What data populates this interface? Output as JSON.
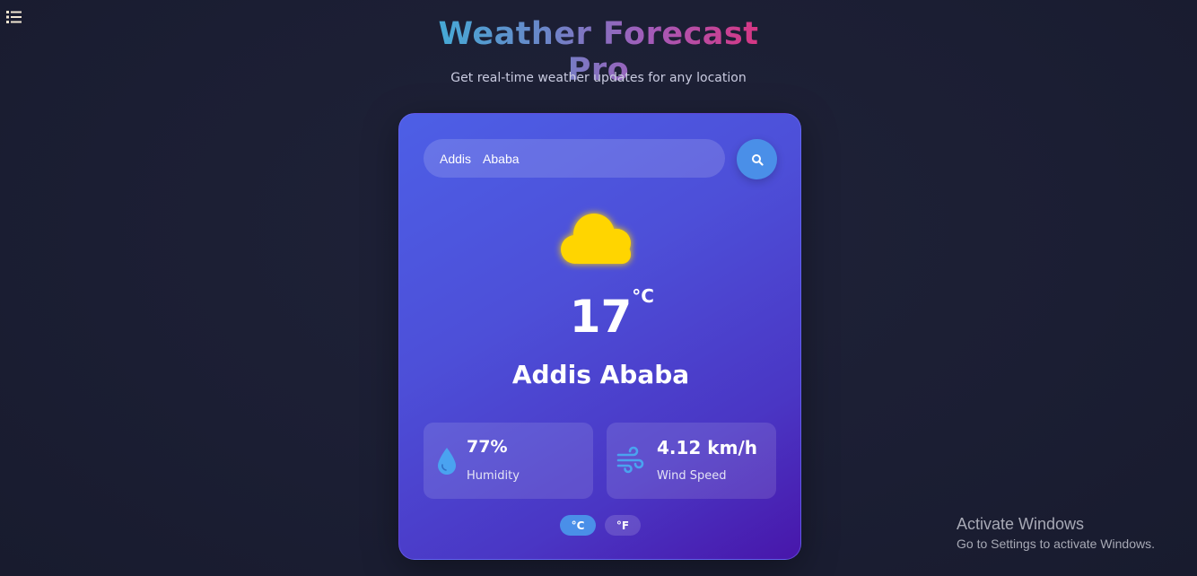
{
  "header": {
    "title": "Weather Forecast Pro",
    "subtitle": "Get real-time weather updates for any location"
  },
  "search": {
    "value": "Addis  Ababa",
    "placeholder": "",
    "button_icon": "search-icon"
  },
  "weather": {
    "icon": "cloud-icon",
    "temperature": "17",
    "unit": "°C",
    "city": "Addis Ababa"
  },
  "details": {
    "humidity": {
      "icon": "water-drop-icon",
      "value": "77%",
      "label": "Humidity"
    },
    "wind": {
      "icon": "wind-icon",
      "value": "4.12 km/h",
      "label": "Wind Speed"
    }
  },
  "unit_toggle": {
    "celsius": "°C",
    "fahrenheit": "°F",
    "active": "celsius"
  },
  "watermark": {
    "title": "Activate Windows",
    "subtitle": "Go to Settings to activate Windows."
  },
  "colors": {
    "background": "#1c1f35",
    "card_gradient_start": "#4d5fe6",
    "card_gradient_end": "#4816aa",
    "accent": "#4a8fe8",
    "cloud": "#ffd500"
  }
}
